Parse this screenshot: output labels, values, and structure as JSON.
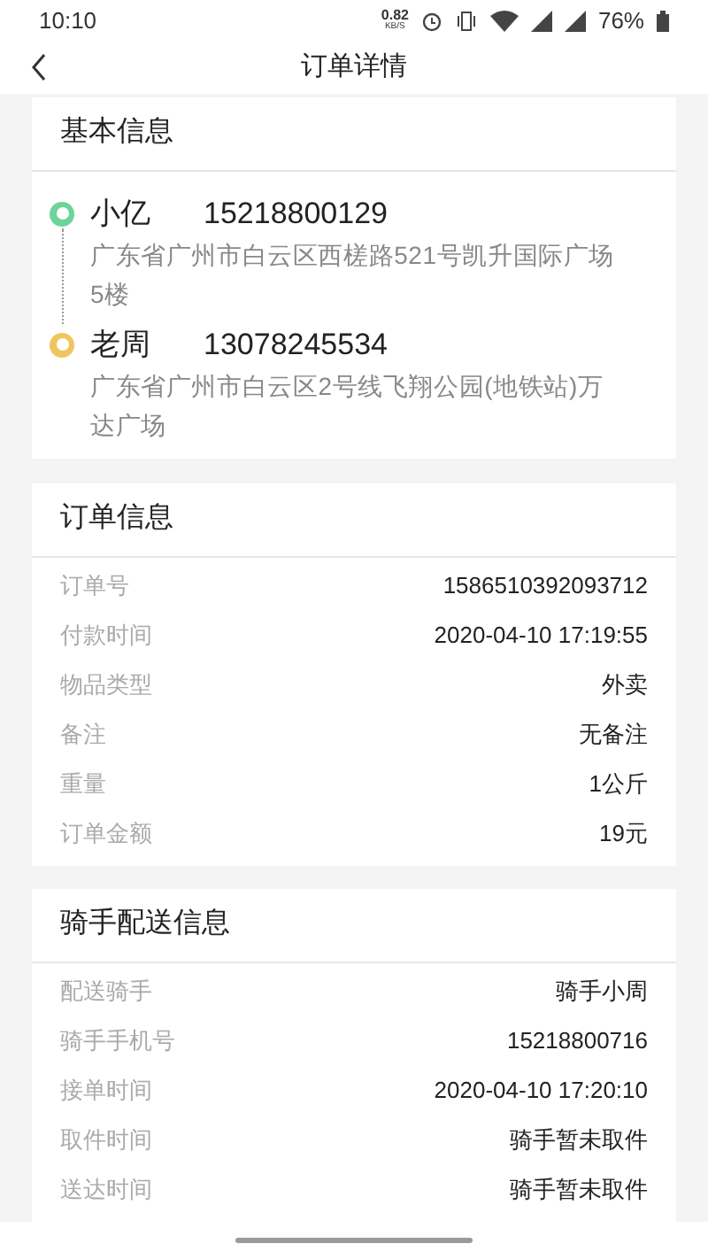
{
  "status_bar": {
    "time": "10:10",
    "net_speed": "0.82",
    "net_unit": "KB/S",
    "battery": "76%"
  },
  "header": {
    "title": "订单详情"
  },
  "basic_info": {
    "title": "基本信息",
    "stops": [
      {
        "name": "小亿",
        "phone": "15218800129",
        "address": "广东省广州市白云区西槎路521号凯升国际广场5楼",
        "color": "#6cd49a"
      },
      {
        "name": "老周",
        "phone": "13078245534",
        "address": "广东省广州市白云区2号线飞翔公园(地铁站)万达广场",
        "color": "#f0c560"
      }
    ]
  },
  "sections": [
    {
      "title": "订单信息",
      "rows": [
        {
          "label": "订单号",
          "value": "1586510392093712"
        },
        {
          "label": "付款时间",
          "value": "2020-04-10 17:19:55"
        },
        {
          "label": "物品类型",
          "value": "外卖"
        },
        {
          "label": "备注",
          "value": "无备注"
        },
        {
          "label": "重量",
          "value": "1公斤"
        },
        {
          "label": "订单金额",
          "value": "19元"
        }
      ]
    },
    {
      "title": "骑手配送信息",
      "rows": [
        {
          "label": "配送骑手",
          "value": "骑手小周"
        },
        {
          "label": "骑手手机号",
          "value": "15218800716"
        },
        {
          "label": "接单时间",
          "value": "2020-04-10 17:20:10"
        },
        {
          "label": "取件时间",
          "value": "骑手暂未取件"
        },
        {
          "label": "送达时间",
          "value": "骑手暂未取件"
        }
      ]
    }
  ]
}
